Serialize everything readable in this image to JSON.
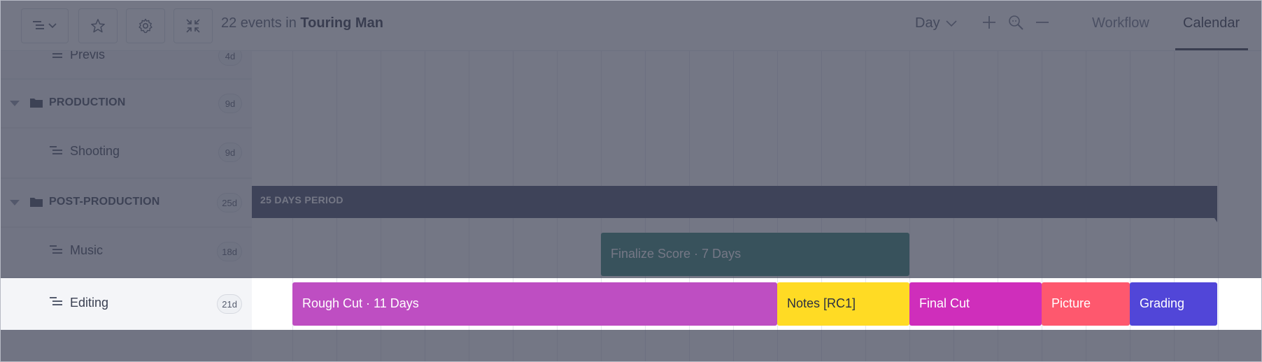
{
  "toolbar": {
    "events_count_text": "22 events in ",
    "project_name": "Touring Man",
    "zoom_level": "Day",
    "tabs": [
      {
        "label": "Workflow",
        "active": false
      },
      {
        "label": "Calendar",
        "active": true
      }
    ],
    "icons": [
      "list-dropdown-icon",
      "star-icon",
      "gear-icon",
      "collapse-icon",
      "plus-icon",
      "zoom-icon",
      "minus-icon"
    ]
  },
  "rows": [
    {
      "label": "Previs",
      "badge": "4d",
      "type": "task"
    },
    {
      "label": "PRODUCTION",
      "badge": "9d",
      "type": "group"
    },
    {
      "label": "Shooting",
      "badge": "9d",
      "type": "task"
    },
    {
      "label": "POST-PRODUCTION",
      "badge": "25d",
      "type": "group"
    },
    {
      "label": "Music",
      "badge": "18d",
      "type": "task"
    },
    {
      "label": "Editing",
      "badge": "21d",
      "type": "task"
    }
  ],
  "timeline": {
    "period_label": "25 DAYS PERIOD",
    "music_events": [
      {
        "label": "Finalize Score · 7 Days",
        "color": "#2a7a6d"
      }
    ],
    "editing_events": [
      {
        "label": "Rough Cut · 11 Days",
        "color": "#be4ec2"
      },
      {
        "label": "Notes [RC1]",
        "color": "#ffdb24"
      },
      {
        "label": "Final Cut",
        "color": "#cf2ebb"
      },
      {
        "label": "Picture",
        "color": "#fe586e"
      },
      {
        "label": "Grading",
        "color": "#5146d8"
      }
    ]
  }
}
